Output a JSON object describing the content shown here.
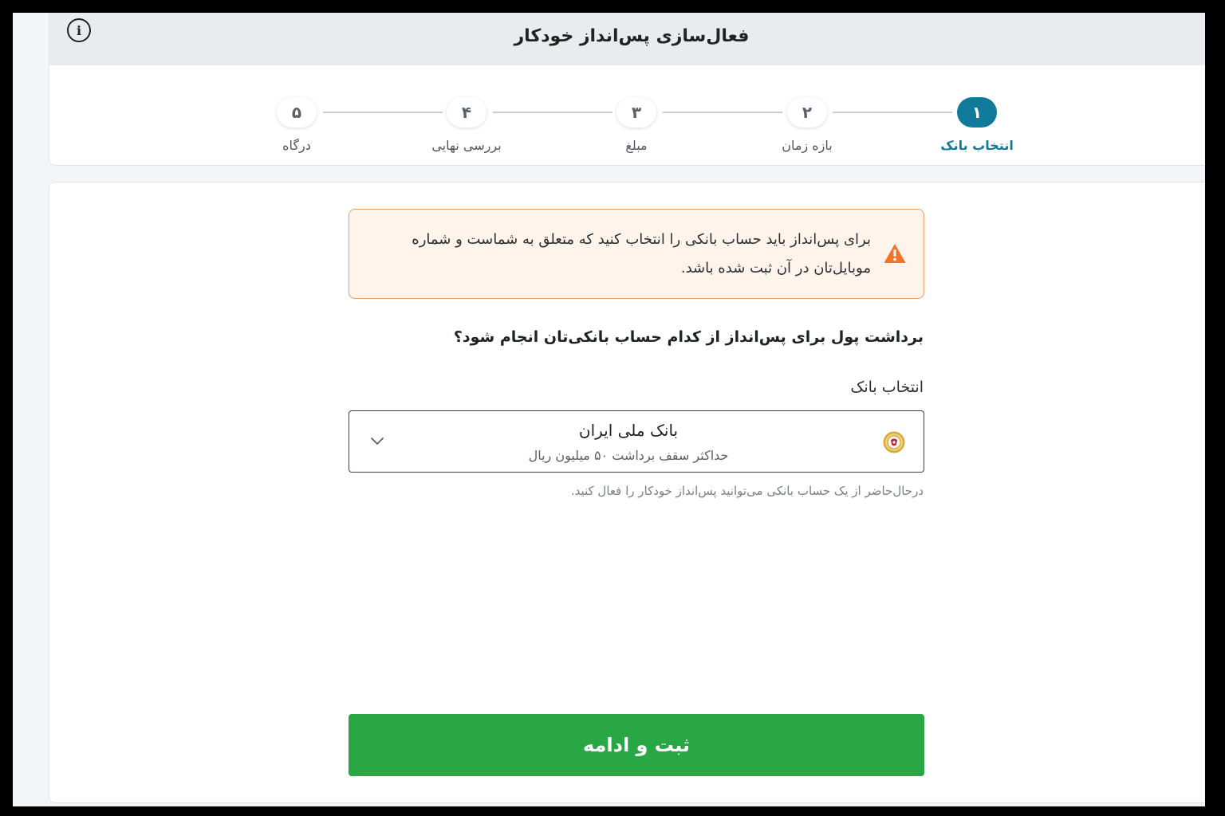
{
  "header": {
    "title": "فعال‌سازی پس‌انداز خودکار",
    "info_icon": "info-icon"
  },
  "stepper": {
    "active_index": 0,
    "steps": [
      {
        "number": "۱",
        "label": "انتخاب بانک"
      },
      {
        "number": "۲",
        "label": "بازه زمان"
      },
      {
        "number": "۳",
        "label": "مبلغ"
      },
      {
        "number": "۴",
        "label": "بررسی نهایی"
      },
      {
        "number": "۵",
        "label": "درگاه"
      }
    ]
  },
  "alert": {
    "icon": "warning-icon",
    "text": "برای پس‌انداز باید حساب بانکی را انتخاب کنید که متعلق به شماست و شماره موبایل‌تان در آن ثبت شده باشد."
  },
  "form": {
    "question": "برداشت پول برای پس‌انداز از کدام حساب بانکی‌تان انجام شود؟",
    "bank_label": "انتخاب بانک",
    "selected_bank": {
      "name": "بانک ملی ایران",
      "limit": "حداکثر سقف برداشت ۵۰ میلیون ریال",
      "logo": "bank-melli-logo"
    },
    "helper": "درحال‌حاضر از یک حساب بانکی می‌توانید پس‌انداز خودکار را فعال کنید."
  },
  "actions": {
    "submit_label": "ثبت و ادامه"
  },
  "colors": {
    "primary": "#11799a",
    "success": "#2aa745",
    "warning": "#f0752a",
    "warning_bg": "#fff4ec"
  }
}
